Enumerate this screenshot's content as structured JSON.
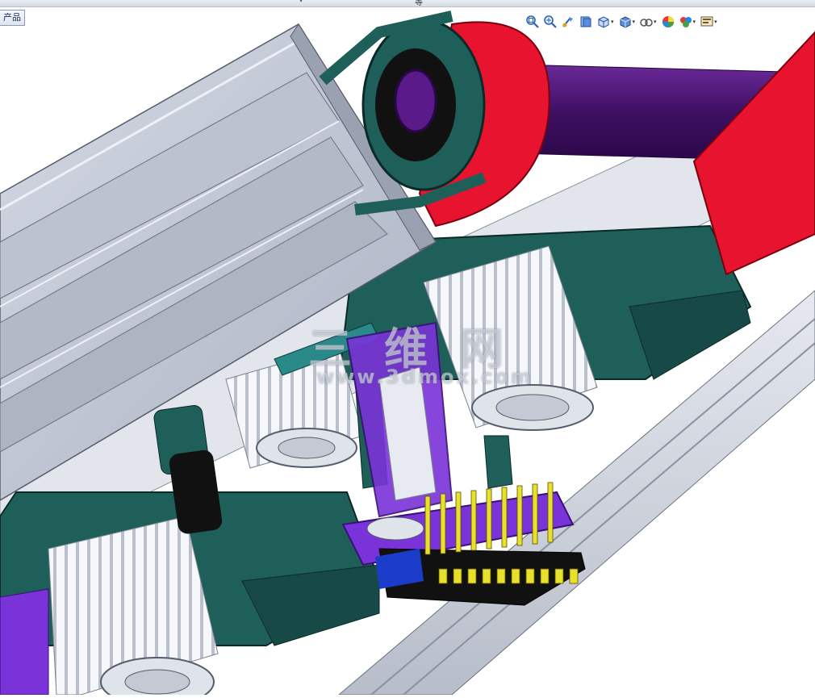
{
  "window": {
    "feature_tab_label": "产品",
    "top_fragment_text": "等",
    "top_arrow": "▾"
  },
  "heads_up_toolbar": {
    "tools": [
      {
        "name": "zoom-to-fit-icon"
      },
      {
        "name": "zoom-to-area-icon"
      },
      {
        "name": "previous-view-icon"
      },
      {
        "name": "section-view-icon"
      },
      {
        "name": "view-orientation-icon",
        "dropdown": true
      },
      {
        "name": "display-style-icon",
        "dropdown": true
      },
      {
        "name": "hide-show-items-icon",
        "dropdown": true
      },
      {
        "name": "edit-appearance-icon"
      },
      {
        "name": "apply-scene-icon",
        "dropdown": true
      },
      {
        "name": "view-settings-icon",
        "dropdown": true
      }
    ],
    "dropdown_glyph": "▾"
  },
  "watermark": {
    "cn_text": "三维网",
    "url_text": "www.3dmox.com"
  },
  "colors": {
    "aluminum": "#c9cfdb",
    "teal_plate": "#1f5f5a",
    "red_bracket": "#e8132e",
    "purple_shaft": "#4a1470",
    "violet_plate": "#7a33d8",
    "pin_gold": "#e8e02a",
    "black_block": "#111111"
  }
}
